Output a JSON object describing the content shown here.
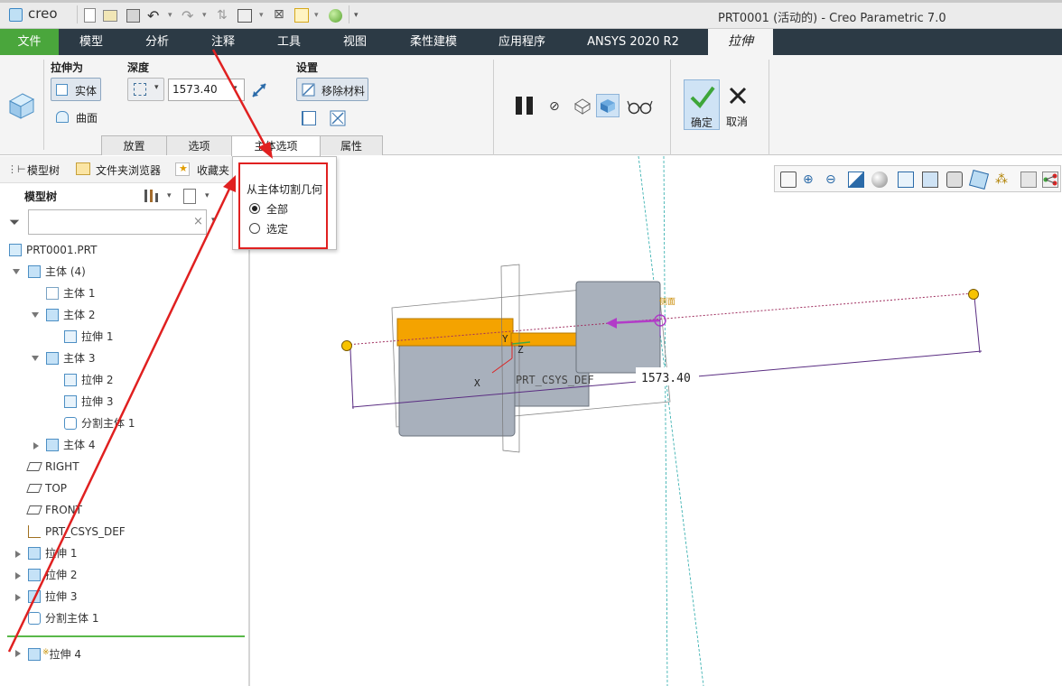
{
  "app": {
    "logo": "creo",
    "title": "PRT0001 (活动的) - Creo Parametric 7.0"
  },
  "menu": {
    "file": "文件",
    "items": [
      "模型",
      "分析",
      "注释",
      "工具",
      "视图",
      "柔性建模",
      "应用程序",
      "ANSYS 2020 R2"
    ],
    "active": "拉伸"
  },
  "ribbon": {
    "extrude_as": {
      "label": "拉伸为",
      "solid": "实体",
      "surface": "曲面"
    },
    "depth": {
      "label": "深度",
      "value": "1573.40"
    },
    "settings": {
      "label": "设置",
      "remove_material": "移除材料"
    },
    "ok": "确定",
    "cancel": "取消",
    "tabs": [
      "放置",
      "选项",
      "主体选项",
      "属性"
    ]
  },
  "popup": {
    "heading": "从主体切割几何",
    "option_all": "全部",
    "option_selected": "选定",
    "selected": "全部"
  },
  "panel": {
    "tabs": {
      "model_tree": "模型树",
      "folder_browser": "文件夹浏览器",
      "favorites": "收藏夹"
    },
    "tree_label": "模型树",
    "search_placeholder": "",
    "items": [
      "PRT0001.PRT",
      "主体 (4)",
      "主体 1",
      "主体 2",
      "拉伸 1",
      "主体 3",
      "拉伸 2",
      "拉伸 3",
      "分割主体 1",
      "主体 4",
      "RIGHT",
      "TOP",
      "FRONT",
      "PRT_CSYS_DEF",
      "拉伸 1",
      "拉伸 2",
      "拉伸 3",
      "分割主体 1",
      "拉伸 4"
    ]
  },
  "viewport": {
    "dimension": "1573.40",
    "csys_label": "PRT_CSYS_DEF",
    "axis_x": "X",
    "axis_y": "Y",
    "axis_z": "Z",
    "side_label": "侧面"
  },
  "colors": {
    "menu_bg": "#2c3a45",
    "file_tab": "#4aa63c",
    "annotation_red": "#e02020",
    "dim_purple": "#5a2d82",
    "orange": "#f0a000"
  }
}
